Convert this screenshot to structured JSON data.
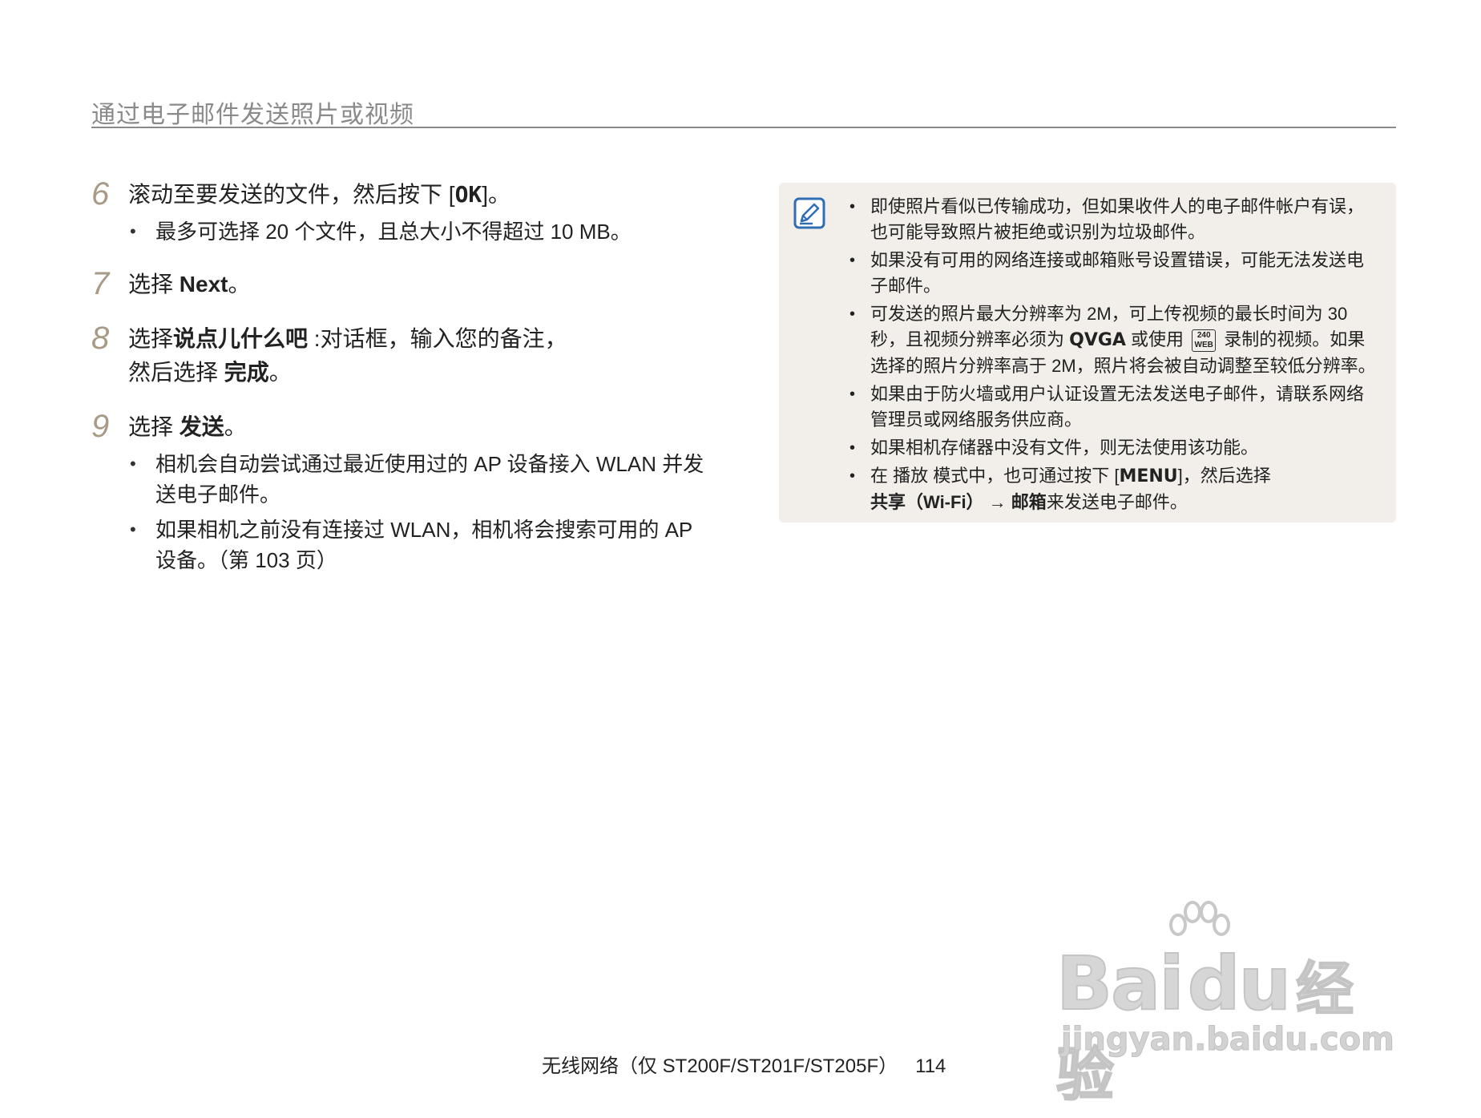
{
  "header": {
    "title": "通过电子邮件发送照片或视频"
  },
  "steps": [
    {
      "num": "6",
      "text_a": "滚动至要发送的文件，然后按下 [",
      "key": "OK",
      "text_b": "]。",
      "bullets": [
        "最多可选择 20 个文件，且总大小不得超过 10 MB。"
      ]
    },
    {
      "num": "7",
      "text_a": "选择 ",
      "bold": "Next",
      "text_b": "。"
    },
    {
      "num": "8",
      "text_a": "选择",
      "bold": "说点儿什么吧",
      "text_b": " :对话框，输入您的备注，",
      "line2_a": "然后选择 ",
      "line2_bold": "完成",
      "line2_b": "。"
    },
    {
      "num": "9",
      "text_a": "选择 ",
      "bold": "发送",
      "text_b": "。",
      "bullets": [
        "相机会自动尝试通过最近使用过的 AP 设备接入 WLAN 并发送电子邮件。",
        "如果相机之前没有连接过 WLAN，相机将会搜索可用的 AP 设备。（第 103 页）"
      ]
    }
  ],
  "note": {
    "icon": "note-pencil-icon",
    "items": [
      "即使照片看似已传输成功，但如果收件人的电子邮件帐户有误，也可能导致照片被拒绝或识别为垃圾邮件。",
      "如果没有可用的网络连接或邮箱账号设置错误，可能无法发送电子邮件。",
      "如果由于防火墙或用户认证设置无法发送电子邮件，请联系网络管理员或网络服务供应商。",
      "如果相机存储器中没有文件，则无法使用该功能。"
    ],
    "item3": {
      "a": "可发送的照片最大分辨率为 2M，可上传视频的最长时间为 30 秒，且视频分辨率必须为 ",
      "qvga": "QVGA",
      "b": " 或使用 ",
      "icon_top": "240",
      "icon_bottom": "WEB",
      "c": " 录制的视频。如果选择的照片分辨率高于 2M，照片将会被自动调整至较低分辨率。"
    },
    "item6": {
      "a": "在  播放  模式中，也可通过按下 [",
      "key": "MENU",
      "b": "]，然后选择",
      "bold1": "共享（Wi-Fi）",
      "arrow": " → ",
      "bold2": "邮箱",
      "c": "来发送电子邮件。"
    }
  },
  "footer": {
    "section": "无线网络（仅 ST200F/ST201F/ST205F）",
    "page": "114"
  },
  "watermark": {
    "main": "Bai",
    "main2": "du",
    "cn": "经验",
    "sub": "jingyan.baidu.com"
  }
}
